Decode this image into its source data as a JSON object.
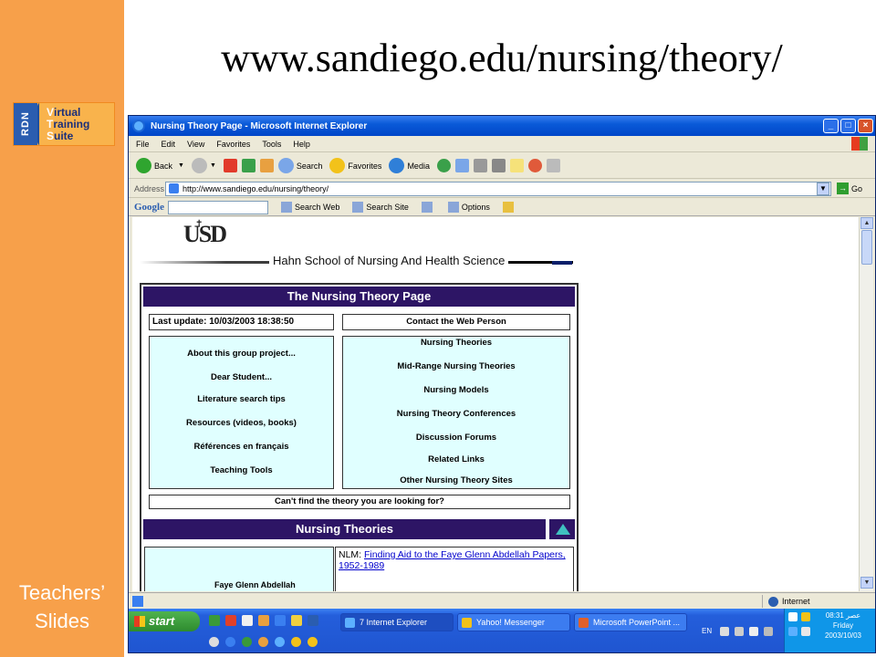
{
  "slide": {
    "heading": "www.sandiego.edu/nursing/theory/",
    "side_label_line1": "Teachers’",
    "side_label_line2": "Slides",
    "logo": {
      "rdn": "RDN",
      "line1_initial": "V",
      "line1_rest": "irtual",
      "line2_initial": "T",
      "line2_rest": "raining",
      "line3_initial": "S",
      "line3_rest": "uite"
    }
  },
  "browser": {
    "window_title": "Nursing Theory Page - Microsoft Internet Explorer",
    "window_buttons": {
      "minimize": "_",
      "maximize": "□",
      "close": "×"
    },
    "menu": [
      "File",
      "Edit",
      "View",
      "Favorites",
      "Tools",
      "Help"
    ],
    "toolbar": {
      "back": "Back",
      "search": "Search",
      "favorites": "Favorites",
      "media": "Media"
    },
    "address_label": "Address",
    "address_value": "http://www.sandiego.edu/nursing/theory/",
    "go_label": "Go",
    "google": {
      "logo": "Google",
      "search_web": "Search Web",
      "search_site": "Search Site",
      "options": "Options"
    },
    "status_zone": "Internet"
  },
  "page": {
    "usd_logo": "USD",
    "school_name": "Hahn School of Nursing And Health Science",
    "main_title": "The Nursing Theory Page",
    "last_update": "Last update: 10/03/2003 18:38:50",
    "contact": "Contact the Web Person",
    "left_links": [
      "About this group project...",
      "Dear Student...",
      "Literature search tips",
      "Resources (videos, books)",
      "Références en français",
      "Teaching Tools"
    ],
    "right_links": [
      "Nursing Theories",
      "Mid-Range Nursing Theories",
      "Nursing Models",
      "Nursing Theory Conferences",
      "Discussion Forums",
      "Related Links",
      "Other Nursing Theory Sites"
    ],
    "cant_find": "Can't find the theory you are looking for?",
    "section_title": "Nursing Theories",
    "nlm_prefix": "NLM: ",
    "nlm_link": "Finding Aid to the Faye Glenn Abdellah Papers, 1952-1989",
    "cutoff_text": "Faye Glenn Abdellah"
  },
  "taskbar": {
    "start": "start",
    "tasks": [
      "7 Internet Explorer",
      "Yahoo! Messenger",
      "Microsoft PowerPoint ..."
    ],
    "lang": "EN",
    "time": "08:31 عصر",
    "day": "Friday",
    "date": "2003/10/03"
  }
}
